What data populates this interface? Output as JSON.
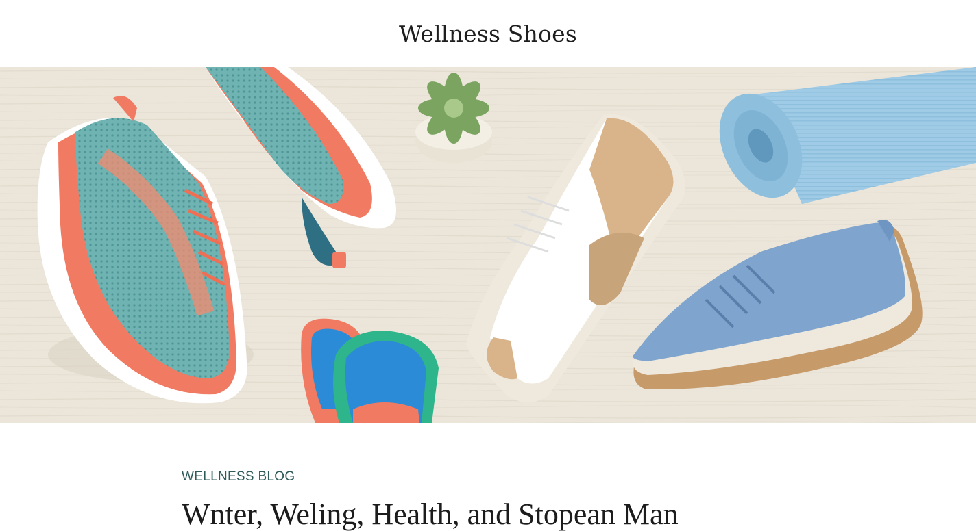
{
  "header": {
    "site_title": "Wellness Shoes"
  },
  "hero": {
    "alt": "Wellness shoes flat lay with sneakers, insoles, succulent and yoga mat",
    "icons": [
      "shoe-teal-coral",
      "shoe-white-tan",
      "shoe-blue-canvas",
      "insoles",
      "succulent-pot",
      "yoga-mat"
    ]
  },
  "article": {
    "eyebrow": "WELLNESS BLOG",
    "title": "Wnter, Weling, Health, and Stopean Man"
  },
  "colors": {
    "eyebrow": "#2f5a5a",
    "title": "#1c1c1c",
    "hero_bg": "#ece6da"
  }
}
